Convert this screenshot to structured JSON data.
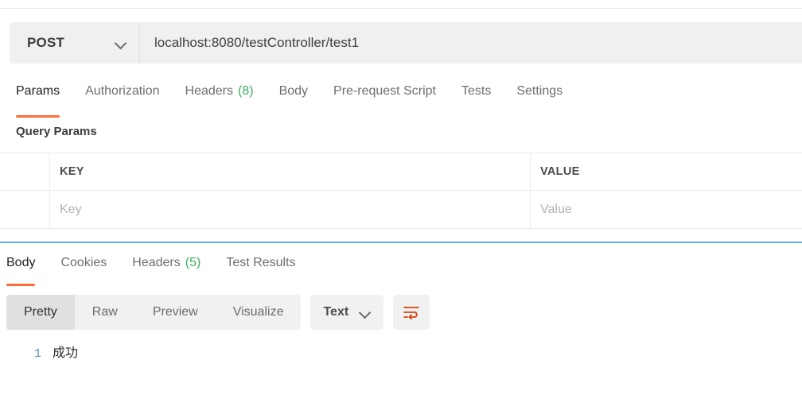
{
  "request": {
    "method": "POST",
    "method_chevron_icon": "chevron-down-icon",
    "url": "localhost:8080/testController/test1",
    "url_placeholder": "Enter request URL",
    "tabs": [
      {
        "label": "Params",
        "count": "",
        "active": true
      },
      {
        "label": "Authorization",
        "count": "",
        "active": false
      },
      {
        "label": "Headers",
        "count": "(8)",
        "active": false
      },
      {
        "label": "Body",
        "count": "",
        "active": false
      },
      {
        "label": "Pre-request Script",
        "count": "",
        "active": false
      },
      {
        "label": "Tests",
        "count": "",
        "active": false
      },
      {
        "label": "Settings",
        "count": "",
        "active": false
      }
    ],
    "query_params": {
      "title": "Query Params",
      "columns": [
        "KEY",
        "VALUE"
      ],
      "rows": [
        {
          "key_placeholder": "Key",
          "value_placeholder": "Value"
        }
      ]
    }
  },
  "response": {
    "tabs": [
      {
        "label": "Body",
        "count": "",
        "active": true
      },
      {
        "label": "Cookies",
        "count": "",
        "active": false
      },
      {
        "label": "Headers",
        "count": "(5)",
        "active": false
      },
      {
        "label": "Test Results",
        "count": "",
        "active": false
      }
    ],
    "view_modes": [
      {
        "label": "Pretty",
        "active": true
      },
      {
        "label": "Raw",
        "active": false
      },
      {
        "label": "Preview",
        "active": false
      },
      {
        "label": "Visualize",
        "active": false
      }
    ],
    "format": {
      "selected": "Text",
      "chevron_icon": "chevron-down-icon"
    },
    "wrap_button_icon": "word-wrap-icon",
    "body_lines": [
      {
        "number": "1",
        "text": "成功"
      }
    ]
  },
  "colors": {
    "accent_orange": "#ff6c37",
    "count_green": "#3bad62",
    "splitter_blue": "#6aa9e9",
    "line_number_blue": "#4a8fb0",
    "field_gray": "#f0f0f0"
  }
}
